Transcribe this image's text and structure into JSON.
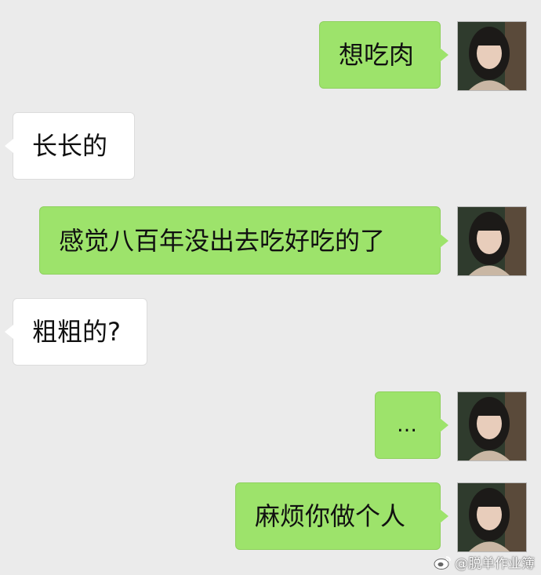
{
  "messages": [
    {
      "side": "right",
      "text": "想吃肉"
    },
    {
      "side": "left",
      "text": "长长的"
    },
    {
      "side": "right",
      "text": "感觉八百年没出去吃好吃的了"
    },
    {
      "side": "left",
      "text": "粗粗的?"
    },
    {
      "side": "right",
      "text": "…"
    },
    {
      "side": "right",
      "text": "麻烦你做个人"
    }
  ],
  "watermark": {
    "text": "@脱单作业簿",
    "icon": "weibo-icon"
  },
  "colors": {
    "background": "#ebebeb",
    "sent_bubble": "#9de36b",
    "received_bubble": "#ffffff"
  }
}
